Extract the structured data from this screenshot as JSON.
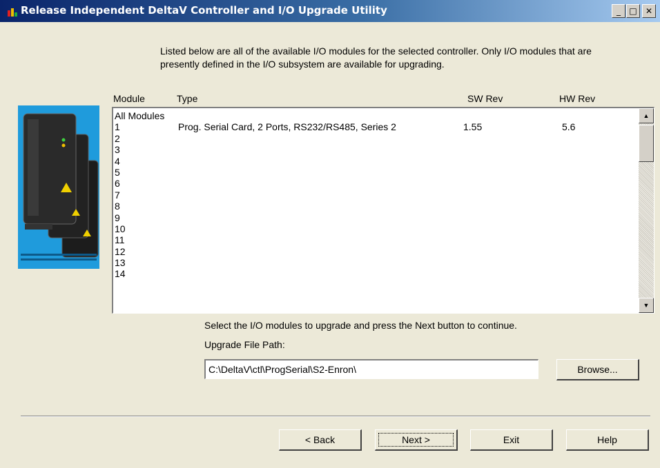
{
  "window": {
    "title": "Release Independent DeltaV Controller and I/O Upgrade Utility",
    "minimize_glyph": "_",
    "maximize_glyph": "□",
    "close_glyph": "✕"
  },
  "intro_text": "Listed below are all of the available I/O modules for the selected controller. Only I/O modules that are presently defined in the I/O subsystem are available for upgrading.",
  "columns": {
    "module": "Module",
    "type": "Type",
    "sw_rev": "SW Rev",
    "hw_rev": "HW Rev"
  },
  "modules": [
    {
      "module": "All Modules",
      "type": "",
      "sw_rev": "",
      "hw_rev": ""
    },
    {
      "module": "1",
      "type": "Prog. Serial Card, 2 Ports, RS232/RS485, Series 2",
      "sw_rev": "1.55",
      "hw_rev": "5.6"
    },
    {
      "module": "2",
      "type": "",
      "sw_rev": "",
      "hw_rev": ""
    },
    {
      "module": "3",
      "type": "",
      "sw_rev": "",
      "hw_rev": ""
    },
    {
      "module": "4",
      "type": "",
      "sw_rev": "",
      "hw_rev": ""
    },
    {
      "module": "5",
      "type": "",
      "sw_rev": "",
      "hw_rev": ""
    },
    {
      "module": "6",
      "type": "",
      "sw_rev": "",
      "hw_rev": ""
    },
    {
      "module": "7",
      "type": "",
      "sw_rev": "",
      "hw_rev": ""
    },
    {
      "module": "8",
      "type": "",
      "sw_rev": "",
      "hw_rev": ""
    },
    {
      "module": "9",
      "type": "",
      "sw_rev": "",
      "hw_rev": ""
    },
    {
      "module": "10",
      "type": "",
      "sw_rev": "",
      "hw_rev": ""
    },
    {
      "module": "11",
      "type": "",
      "sw_rev": "",
      "hw_rev": ""
    },
    {
      "module": "12",
      "type": "",
      "sw_rev": "",
      "hw_rev": ""
    },
    {
      "module": "13",
      "type": "",
      "sw_rev": "",
      "hw_rev": ""
    },
    {
      "module": "14",
      "type": "",
      "sw_rev": "",
      "hw_rev": ""
    }
  ],
  "scrollbar": {
    "up_glyph": "▲",
    "down_glyph": "▼"
  },
  "instruction_text": "Select the I/O modules to upgrade and press the Next button to continue.",
  "upgrade_path": {
    "label": "Upgrade File Path:",
    "value": "C:\\DeltaV\\ctl\\ProgSerial\\S2-Enron\\"
  },
  "buttons": {
    "browse": "Browse...",
    "back": "< Back",
    "next": "Next >",
    "exit": "Exit",
    "help": "Help"
  },
  "colors": {
    "title_bar": "#0a246a",
    "dialog_bg": "#ece9d8",
    "photo_bg": "#1f9bdc"
  }
}
